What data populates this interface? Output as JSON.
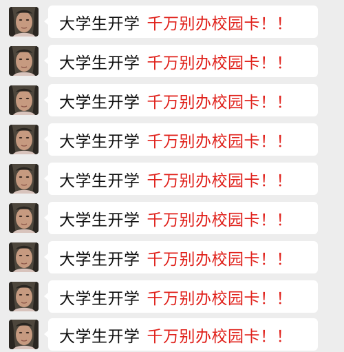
{
  "chat": {
    "messages": [
      {
        "sender_avatar": "profile-photo",
        "text_normal": "大学生开学",
        "text_highlight": "千万别办校园卡！！"
      },
      {
        "sender_avatar": "profile-photo",
        "text_normal": "大学生开学",
        "text_highlight": "千万别办校园卡！！"
      },
      {
        "sender_avatar": "profile-photo",
        "text_normal": "大学生开学",
        "text_highlight": "千万别办校园卡！！"
      },
      {
        "sender_avatar": "profile-photo",
        "text_normal": "大学生开学",
        "text_highlight": "千万别办校园卡！！"
      },
      {
        "sender_avatar": "profile-photo",
        "text_normal": "大学生开学",
        "text_highlight": "千万别办校园卡！！"
      },
      {
        "sender_avatar": "profile-photo",
        "text_normal": "大学生开学",
        "text_highlight": "千万别办校园卡！！"
      },
      {
        "sender_avatar": "profile-photo",
        "text_normal": "大学生开学",
        "text_highlight": "千万别办校园卡！！"
      },
      {
        "sender_avatar": "profile-photo",
        "text_normal": "大学生开学",
        "text_highlight": "千万别办校园卡！！"
      },
      {
        "sender_avatar": "profile-photo",
        "text_normal": "大学生开学",
        "text_highlight": "千万别办校园卡！！"
      }
    ]
  },
  "colors": {
    "background": "#ededed",
    "bubble": "#ffffff",
    "text_normal": "#111111",
    "text_highlight": "#e0211b"
  }
}
